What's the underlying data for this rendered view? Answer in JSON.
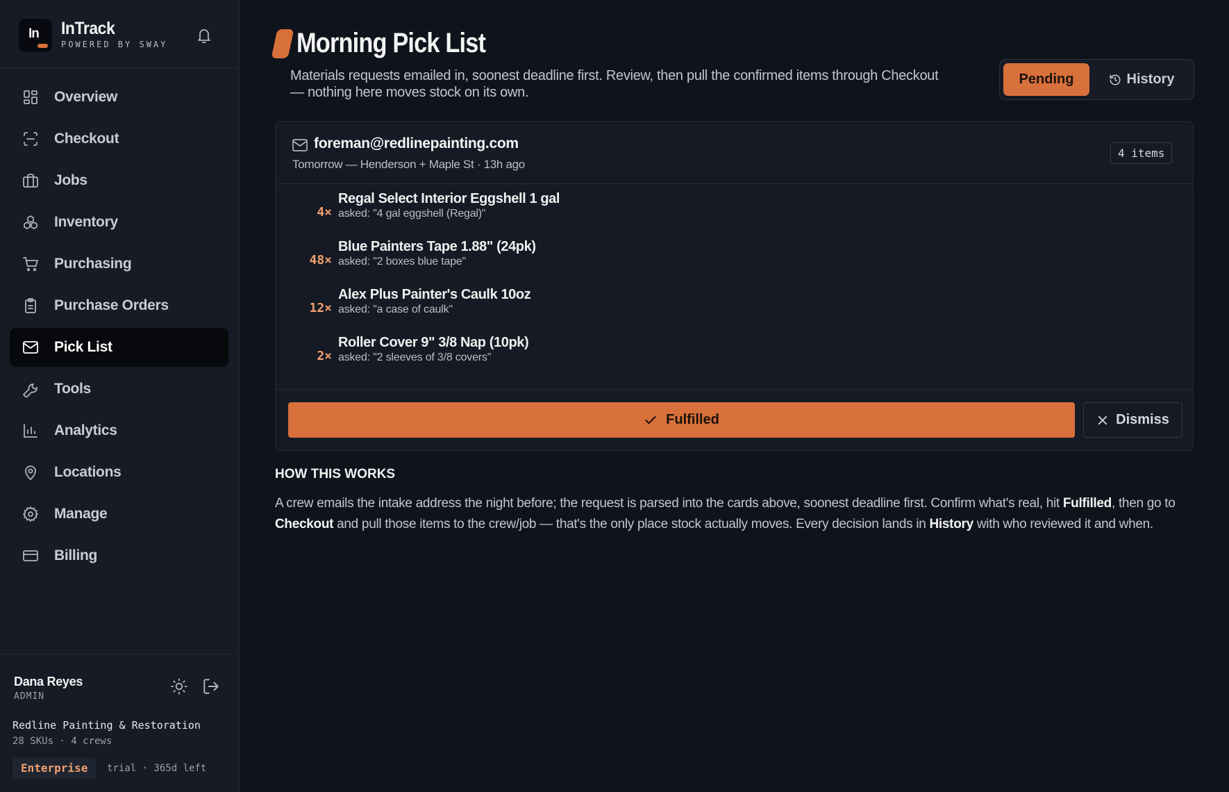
{
  "brand": {
    "logo_text": "In",
    "name": "InTrack",
    "tagline": "POWERED BY SWAY"
  },
  "sidebar": {
    "items": [
      {
        "label": "Overview",
        "icon": "grid-icon"
      },
      {
        "label": "Checkout",
        "icon": "scan-icon"
      },
      {
        "label": "Jobs",
        "icon": "briefcase-icon"
      },
      {
        "label": "Inventory",
        "icon": "boxes-icon"
      },
      {
        "label": "Purchasing",
        "icon": "cart-icon"
      },
      {
        "label": "Purchase Orders",
        "icon": "clipboard-icon"
      },
      {
        "label": "Pick List",
        "icon": "mail-icon",
        "active": true
      },
      {
        "label": "Tools",
        "icon": "wrench-icon"
      },
      {
        "label": "Analytics",
        "icon": "bar-chart-icon"
      },
      {
        "label": "Locations",
        "icon": "map-pin-icon"
      },
      {
        "label": "Manage",
        "icon": "gear-icon"
      },
      {
        "label": "Billing",
        "icon": "credit-card-icon"
      }
    ]
  },
  "user": {
    "name": "Dana Reyes",
    "role": "ADMIN"
  },
  "org": {
    "name": "Redline Painting & Restoration",
    "stats": "28 SKUs · 4 crews",
    "plan": "Enterprise",
    "trial": "trial · 365d left"
  },
  "page": {
    "title": "Morning Pick List",
    "description": "Materials requests emailed in, soonest deadline first. Review, then pull the confirmed items through Checkout — nothing here moves stock on its own."
  },
  "tabs": {
    "pending": "Pending",
    "history": "History"
  },
  "request": {
    "sender": "foreman@redlinepainting.com",
    "meta": "Tomorrow — Henderson + Maple St · 13h ago",
    "count": "4 items",
    "items": [
      {
        "qty": "4×",
        "name": "Regal Select Interior Eggshell 1 gal",
        "asked": "asked: \"4 gal eggshell (Regal)\""
      },
      {
        "qty": "48×",
        "name": "Blue Painters Tape 1.88\" (24pk)",
        "asked": "asked: \"2 boxes blue tape\""
      },
      {
        "qty": "12×",
        "name": "Alex Plus Painter's Caulk 10oz",
        "asked": "asked: \"a case of caulk\""
      },
      {
        "qty": "2×",
        "name": "Roller Cover 9\" 3/8 Nap (10pk)",
        "asked": "asked: \"2 sleeves of 3/8 covers\""
      }
    ],
    "fulfilled_label": "Fulfilled",
    "dismiss_label": "Dismiss"
  },
  "how": {
    "title": "HOW THIS WORKS",
    "p1": "A crew emails the intake address the night before; the request is parsed into the cards above, soonest deadline first. Confirm what's real, hit ",
    "b1": "Fulfilled",
    "p2": ", then go to ",
    "b2": "Checkout",
    "p3": " and pull those items to the crew/job — that's the only place stock actually moves. Every decision lands in ",
    "b3": "History",
    "p4": " with who reviewed it and when."
  },
  "colors": {
    "accent": "#d8703c",
    "background": "#0f131b",
    "sidebar": "#161b25"
  }
}
